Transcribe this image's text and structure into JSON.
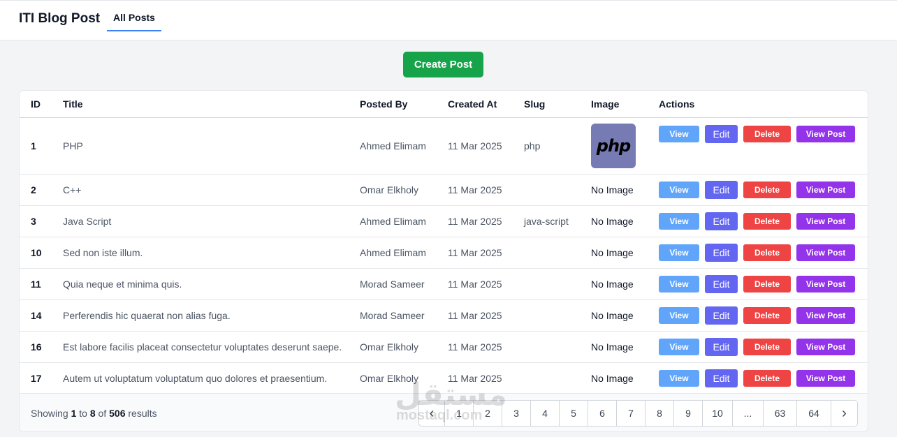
{
  "nav": {
    "brand": "ITI Blog Post",
    "tab_all_posts": "All Posts"
  },
  "create_button": "Create Post",
  "table": {
    "headers": [
      "ID",
      "Title",
      "Posted By",
      "Created At",
      "Slug",
      "Image",
      "Actions"
    ],
    "rows": [
      {
        "id": "1",
        "title": "PHP",
        "posted_by": "Ahmed Elimam",
        "created_at": "11 Mar 2025",
        "slug": "php",
        "image": "php"
      },
      {
        "id": "2",
        "title": "C++",
        "posted_by": "Omar Elkholy",
        "created_at": "11 Mar 2025",
        "slug": "",
        "image": "No Image"
      },
      {
        "id": "3",
        "title": "Java Script",
        "posted_by": "Ahmed Elimam",
        "created_at": "11 Mar 2025",
        "slug": "java-script",
        "image": "No Image"
      },
      {
        "id": "10",
        "title": "Sed non iste illum.",
        "posted_by": "Ahmed Elimam",
        "created_at": "11 Mar 2025",
        "slug": "",
        "image": "No Image"
      },
      {
        "id": "11",
        "title": "Quia neque et minima quis.",
        "posted_by": "Morad Sameer",
        "created_at": "11 Mar 2025",
        "slug": "",
        "image": "No Image"
      },
      {
        "id": "14",
        "title": "Perferendis hic quaerat non alias fuga.",
        "posted_by": "Morad Sameer",
        "created_at": "11 Mar 2025",
        "slug": "",
        "image": "No Image"
      },
      {
        "id": "16",
        "title": "Est labore facilis placeat consectetur voluptates deserunt saepe.",
        "posted_by": "Omar Elkholy",
        "created_at": "11 Mar 2025",
        "slug": "",
        "image": "No Image"
      },
      {
        "id": "17",
        "title": "Autem ut voluptatum voluptatum quo dolores et praesentium.",
        "posted_by": "Omar Elkholy",
        "created_at": "11 Mar 2025",
        "slug": "",
        "image": "No Image"
      }
    ],
    "actions": {
      "view": "View",
      "edit": "Edit",
      "delete": "Delete",
      "view_post": "View Post"
    }
  },
  "footer": {
    "showing_prefix": "Showing",
    "from": "1",
    "to_word": "to",
    "to": "8",
    "of_word": "of",
    "total": "506",
    "results_word": "results"
  },
  "pagination": {
    "prev_icon": "chevron-left-icon",
    "next_icon": "chevron-right-icon",
    "pages": [
      "1",
      "2",
      "3",
      "4",
      "5",
      "6",
      "7",
      "8",
      "9",
      "10",
      "...",
      "63",
      "64"
    ]
  },
  "watermark": {
    "arabic": "مستقل",
    "latin": "mostaql.com"
  },
  "colors": {
    "create": "#16a34a",
    "view": "#60a5fa",
    "edit": "#6366f1",
    "delete": "#ef4444",
    "view_post": "#9333ea",
    "tab_underline": "#3b82f6",
    "php_logo_bg": "#777bb3"
  }
}
